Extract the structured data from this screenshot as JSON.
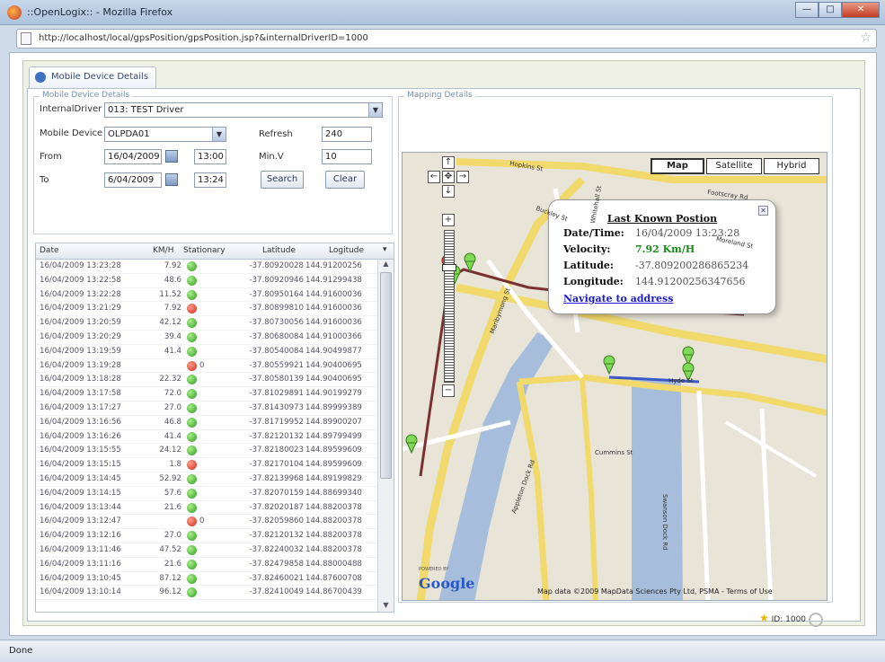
{
  "window": {
    "title": "::OpenLogix:: - Mozilla Firefox",
    "url": "http://localhost/local/gpsPosition/gpsPosition.jsp?&internalDriverID=1000",
    "status": "Done"
  },
  "tab": {
    "label": "Mobile Device Details"
  },
  "details": {
    "legend": "Mobile Device Details",
    "internal_driver_label": "InternalDriver",
    "internal_driver_value": "013: TEST Driver",
    "mobile_device_label": "Mobile Device",
    "mobile_device_value": "OLPDA01",
    "refresh_label": "Refresh",
    "refresh_value": "240",
    "from_label": "From",
    "from_date": "16/04/2009",
    "from_time": "13:00",
    "min_v_label": "Min.V",
    "min_v_value": "10",
    "to_label": "To",
    "to_date": "6/04/2009",
    "to_time": "13:24",
    "search_label": "Search",
    "clear_label": "Clear"
  },
  "grid": {
    "headers": [
      "Date",
      "KM/H",
      "Stationary",
      "Latitude",
      "Logitude"
    ],
    "rows": [
      {
        "date": "16/04/2009 13:23:28",
        "kmh": "7.92",
        "stat": "green",
        "n": "",
        "lat": "-37.80920028",
        "lng": "144.91200256"
      },
      {
        "date": "16/04/2009 13:22:58",
        "kmh": "48.6",
        "stat": "green",
        "n": "",
        "lat": "-37.80920946",
        "lng": "144.91299438"
      },
      {
        "date": "16/04/2009 13:22:28",
        "kmh": "11.52",
        "stat": "green",
        "n": "",
        "lat": "-37.80950164",
        "lng": "144.91600036"
      },
      {
        "date": "16/04/2009 13:21:29",
        "kmh": "7.92",
        "stat": "red",
        "n": "",
        "lat": "-37.80899810",
        "lng": "144.91600036"
      },
      {
        "date": "16/04/2009 13:20:59",
        "kmh": "42.12",
        "stat": "green",
        "n": "",
        "lat": "-37.80730056",
        "lng": "144.91600036"
      },
      {
        "date": "16/04/2009 13:20:29",
        "kmh": "39.4",
        "stat": "green",
        "n": "",
        "lat": "-37.80680084",
        "lng": "144.91000366"
      },
      {
        "date": "16/04/2009 13:19:59",
        "kmh": "41.4",
        "stat": "green",
        "n": "",
        "lat": "-37.80540084",
        "lng": "144.90499877"
      },
      {
        "date": "16/04/2009 13:19:28",
        "kmh": "",
        "stat": "red",
        "n": "0",
        "lat": "-37.80559921",
        "lng": "144.90400695"
      },
      {
        "date": "16/04/2009 13:18:28",
        "kmh": "22.32",
        "stat": "green",
        "n": "",
        "lat": "-37.80580139",
        "lng": "144.90400695"
      },
      {
        "date": "16/04/2009 13:17:58",
        "kmh": "72.0",
        "stat": "green",
        "n": "",
        "lat": "-37.81029891",
        "lng": "144.90199279"
      },
      {
        "date": "16/04/2009 13:17:27",
        "kmh": "27.0",
        "stat": "green",
        "n": "",
        "lat": "-37.81430973",
        "lng": "144.89999389"
      },
      {
        "date": "16/04/2009 13:16:56",
        "kmh": "46.8",
        "stat": "green",
        "n": "",
        "lat": "-37.81719952",
        "lng": "144.89900207"
      },
      {
        "date": "16/04/2009 13:16:26",
        "kmh": "41.4",
        "stat": "green",
        "n": "",
        "lat": "-37.82120132",
        "lng": "144.89799499"
      },
      {
        "date": "16/04/2009 13:15:55",
        "kmh": "24.12",
        "stat": "green",
        "n": "",
        "lat": "-37.82180023",
        "lng": "144.89599609"
      },
      {
        "date": "16/04/2009 13:15:15",
        "kmh": "1.8",
        "stat": "red",
        "n": "",
        "lat": "-37.82170104",
        "lng": "144.89599609"
      },
      {
        "date": "16/04/2009 13:14:45",
        "kmh": "52.92",
        "stat": "green",
        "n": "",
        "lat": "-37.82139968",
        "lng": "144.89199829"
      },
      {
        "date": "16/04/2009 13:14:15",
        "kmh": "57.6",
        "stat": "green",
        "n": "",
        "lat": "-37.82070159",
        "lng": "144.88699340"
      },
      {
        "date": "16/04/2009 13:13:44",
        "kmh": "21.6",
        "stat": "green",
        "n": "",
        "lat": "-37.82020187",
        "lng": "144.88200378"
      },
      {
        "date": "16/04/2009 13:12:47",
        "kmh": "",
        "stat": "red",
        "n": "0",
        "lat": "-37.82059860",
        "lng": "144.88200378"
      },
      {
        "date": "16/04/2009 13:12:16",
        "kmh": "27.0",
        "stat": "green",
        "n": "",
        "lat": "-37.82120132",
        "lng": "144.88200378"
      },
      {
        "date": "16/04/2009 13:11:46",
        "kmh": "47.52",
        "stat": "green",
        "n": "",
        "lat": "-37.82240032",
        "lng": "144.88200378"
      },
      {
        "date": "16/04/2009 13:11:16",
        "kmh": "21.6",
        "stat": "green",
        "n": "",
        "lat": "-37.82479858",
        "lng": "144.88000488"
      },
      {
        "date": "16/04/2009 13:10:45",
        "kmh": "87.12",
        "stat": "green",
        "n": "",
        "lat": "-37.82460021",
        "lng": "144.87600708"
      },
      {
        "date": "16/04/2009 13:10:14",
        "kmh": "96.12",
        "stat": "green",
        "n": "",
        "lat": "-37.82410049",
        "lng": "144.86700439"
      }
    ]
  },
  "mapping": {
    "legend": "Mapping Details",
    "map_types": [
      "Map",
      "Satellite",
      "Hybrid"
    ],
    "info": {
      "title": "Last Known Postion",
      "date_label": "Date/Time:",
      "date_value": "16/04/2009 13:23:28",
      "velocity_label": "Velocity:",
      "velocity_value": "7.92 Km/H",
      "latitude_label": "Latitude:",
      "latitude_value": "-37.809200286865234",
      "longitude_label": "Longitude:",
      "longitude_value": "144.91200256347656",
      "navigate_label": "Navigate to address"
    },
    "google_powered": "POWERED BY",
    "google_label": "Google",
    "copyright": "Map data ©2009 MapData Sciences Pty Ltd, PSMA - Terms of Use",
    "street_labels": [
      "Hopkins St",
      "Footscray Rd",
      "Maribyrnong St",
      "Whitehall St",
      "Hyde St",
      "Moreland St",
      "Buckley St",
      "Cummins St",
      "Swanson Dock Rd",
      "Appleton Dock Rd"
    ]
  },
  "footer": {
    "id_label": "ID: 1000"
  }
}
